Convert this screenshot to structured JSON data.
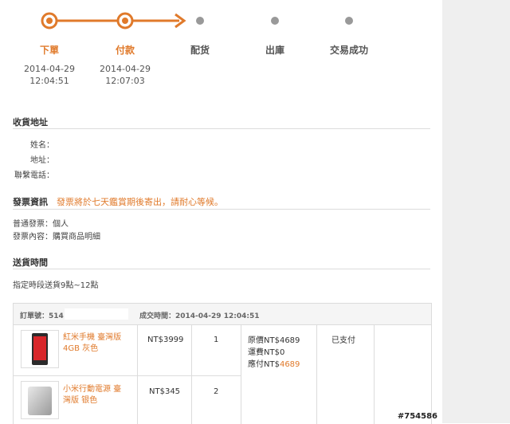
{
  "progress": {
    "steps": [
      {
        "label": "下單",
        "date": "2014-04-29",
        "time": "12:04:51",
        "status": "done"
      },
      {
        "label": "付款",
        "date": "2014-04-29",
        "time": "12:07:03",
        "status": "done"
      },
      {
        "label": "配货",
        "status": "pending"
      },
      {
        "label": "出庫",
        "status": "pending"
      },
      {
        "label": "交易成功",
        "status": "pending"
      }
    ],
    "colors": {
      "done": "#e07a2b",
      "pending": "#999999"
    }
  },
  "address": {
    "title": "收貨地址",
    "name_label": "姓名：",
    "addr_label": "地址：",
    "phone_label": "聯繫電話："
  },
  "invoice": {
    "title": "發票資訊",
    "note": "發票將於七天鑑賞期後寄出，請耐心等候。",
    "type_line": "普通發票：個人",
    "content_line": "發票內容：購買商品明細"
  },
  "delivery": {
    "title": "送貨時間",
    "value": "指定時段送貨9點~12點"
  },
  "order": {
    "number_label": "訂單號：514",
    "time_label": "成交時間：2014-04-29 12:04:51",
    "items": [
      {
        "name_line1": "紅米手機 臺灣版",
        "name_line2": "4GB 灰色",
        "price": "NT$3999",
        "qty": "1",
        "image": "phone-image"
      },
      {
        "name_line1": "小米行動電源 臺",
        "name_line2": "灣版 银色",
        "price": "NT$345",
        "qty": "2",
        "image": "power-bank-image"
      }
    ],
    "summary": {
      "original_label": "原價NT$4689",
      "shipping_label": "運費NT$0",
      "payable_prefix": "應付NT$",
      "payable_value": "4689"
    },
    "status": "已支付"
  },
  "watermark": "#754586"
}
